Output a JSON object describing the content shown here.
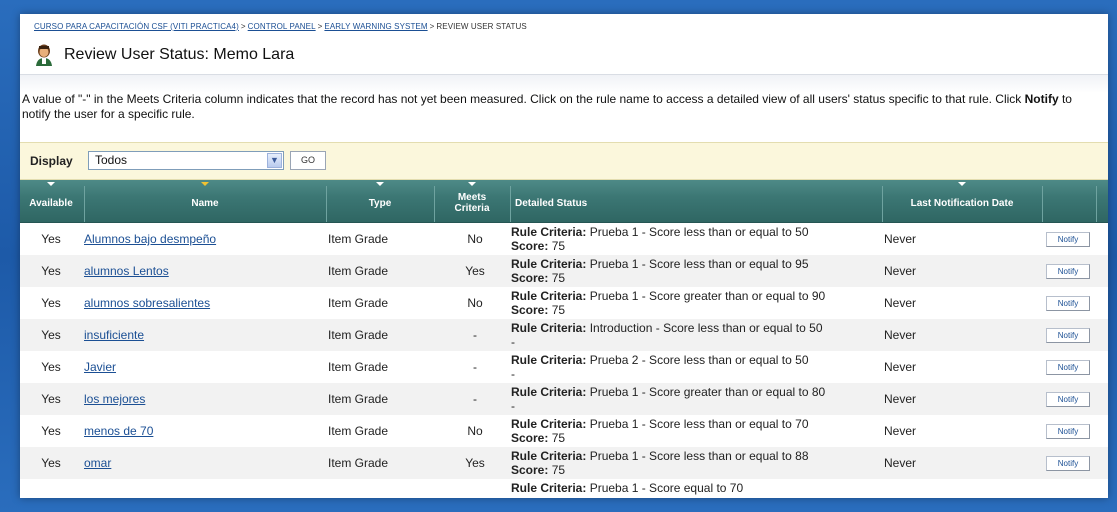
{
  "breadcrumb": {
    "items": [
      "CURSO PARA CAPACITACIÓN CSF (VITI PRACTICA4)",
      "CONTROL PANEL",
      "EARLY WARNING SYSTEM"
    ],
    "separator": ">",
    "current": "REVIEW USER STATUS"
  },
  "page": {
    "title": "Review User Status: Memo Lara",
    "intro_part1": "A value of \"-\" in the Meets Criteria column indicates that the record has not yet been measured. Click on the rule name to access a detailed view of all users' status specific to that rule. Click ",
    "intro_bold": "Notify",
    "intro_part2": " to notify the user for a specific rule."
  },
  "filter": {
    "label": "Display",
    "selected": "Todos",
    "go_label": "GO"
  },
  "table": {
    "headers": {
      "available": "Available",
      "name": "Name",
      "type": "Type",
      "meets": "Meets Criteria",
      "status": "Detailed Status",
      "date": "Last Notification Date"
    },
    "rule_label": "Rule Criteria:",
    "score_label": "Score:",
    "notify_label": "Notify",
    "rows": [
      {
        "available": "Yes",
        "name": "Alumnos bajo desmpeño",
        "type": "Item Grade",
        "meets": "No",
        "rule": " Prueba 1 - Score less than or equal to 50",
        "score": " 75",
        "date": "Never"
      },
      {
        "available": "Yes",
        "name": "alumnos Lentos",
        "type": "Item Grade",
        "meets": "Yes",
        "rule": " Prueba 1 - Score less than or equal to 95",
        "score": " 75",
        "date": "Never"
      },
      {
        "available": "Yes",
        "name": "alumnos sobresalientes",
        "type": "Item Grade",
        "meets": "No",
        "rule": " Prueba 1 - Score greater than or equal to 90",
        "score": " 75",
        "date": "Never"
      },
      {
        "available": "Yes",
        "name": "insuficiente",
        "type": "Item Grade",
        "meets": "-",
        "rule": " Introduction - Score less than or equal to 50",
        "score": "-",
        "date": "Never"
      },
      {
        "available": "Yes",
        "name": "Javier",
        "type": "Item Grade",
        "meets": "-",
        "rule": " Prueba 2 - Score less than or equal to 50",
        "score": "-",
        "date": "Never"
      },
      {
        "available": "Yes",
        "name": "los mejores",
        "type": "Item Grade",
        "meets": "-",
        "rule": " Prueba 1 - Score greater than or equal to 80",
        "score": "-",
        "date": "Never"
      },
      {
        "available": "Yes",
        "name": "menos de 70",
        "type": "Item Grade",
        "meets": "No",
        "rule": " Prueba 1 - Score less than or equal to 70",
        "score": " 75",
        "date": "Never"
      },
      {
        "available": "Yes",
        "name": "omar",
        "type": "Item Grade",
        "meets": "Yes",
        "rule": " Prueba 1 - Score less than or equal to 88",
        "score": " 75",
        "date": "Never"
      },
      {
        "available": "",
        "name": "",
        "type": "",
        "meets": "",
        "rule": " Prueba 1 - Score equal to 70",
        "score": "",
        "date": ""
      }
    ]
  }
}
